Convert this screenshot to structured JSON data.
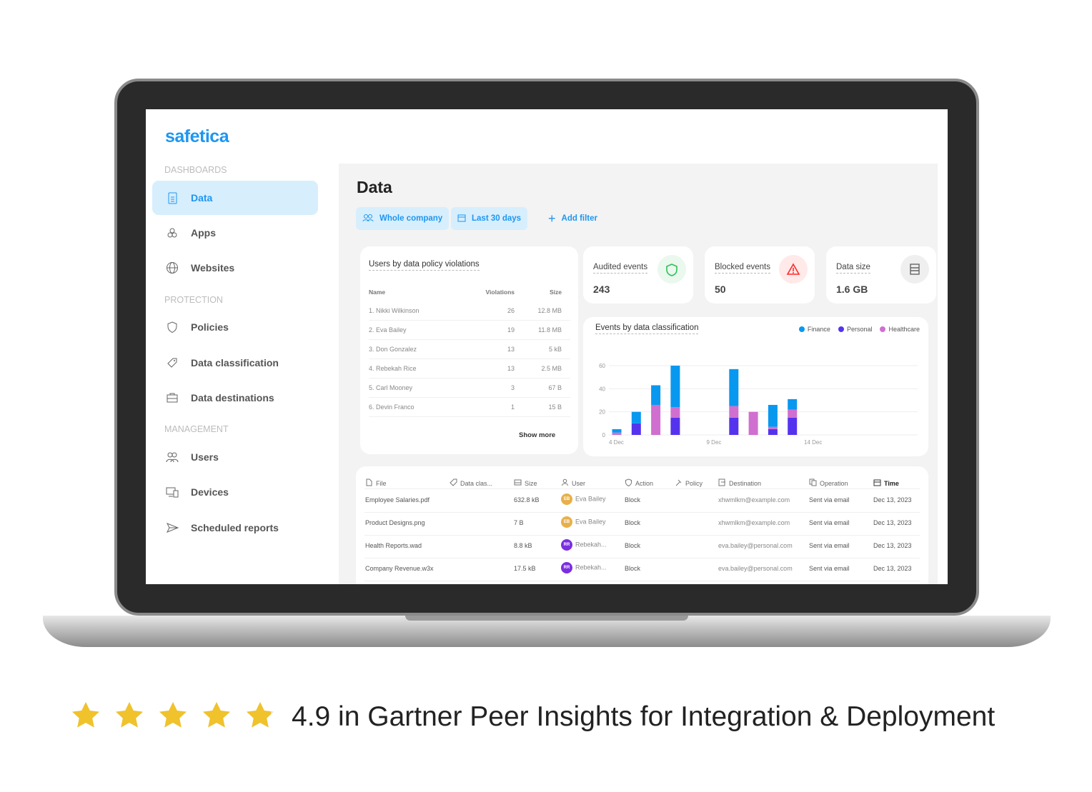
{
  "app": {
    "logo": "safetica"
  },
  "sidebar": {
    "sections": [
      {
        "label": "DASHBOARDS",
        "items": [
          {
            "label": "Data",
            "icon": "document-icon",
            "active": true
          },
          {
            "label": "Apps",
            "icon": "apps-icon"
          },
          {
            "label": "Websites",
            "icon": "globe-icon"
          }
        ]
      },
      {
        "label": "PROTECTION",
        "items": [
          {
            "label": "Policies",
            "icon": "shield-icon"
          },
          {
            "label": "Data classification",
            "icon": "tag-icon"
          },
          {
            "label": "Data destinations",
            "icon": "briefcase-icon"
          }
        ]
      },
      {
        "label": "MANAGEMENT",
        "items": [
          {
            "label": "Users",
            "icon": "users-icon"
          },
          {
            "label": "Devices",
            "icon": "devices-icon"
          },
          {
            "label": "Scheduled reports",
            "icon": "send-icon"
          }
        ]
      }
    ]
  },
  "main": {
    "title": "Data",
    "filters": [
      {
        "label": "Whole company",
        "icon": "users-icon"
      },
      {
        "label": "Last 30 days",
        "icon": "calendar-icon"
      }
    ],
    "add_filter": "Add filter"
  },
  "violations": {
    "title": "Users by data policy violations",
    "columns": [
      "Name",
      "Violations",
      "Size"
    ],
    "rows": [
      [
        "1. Nikki Wilkinson",
        "26",
        "12.8 MB"
      ],
      [
        "2. Eva Bailey",
        "19",
        "11.8 MB"
      ],
      [
        "3. Don Gonzalez",
        "13",
        "5 kB"
      ],
      [
        "4. Rebekah Rice",
        "13",
        "2.5 MB"
      ],
      [
        "5. Carl Mooney",
        "3",
        "67 B"
      ],
      [
        "6. Devin Franco",
        "1",
        "15 B"
      ]
    ],
    "show_more": "Show more"
  },
  "kpis": [
    {
      "label": "Audited events",
      "value": "243",
      "icon": "shield-check-icon",
      "color": "#2fbf5a",
      "bg": "#eaf8ee"
    },
    {
      "label": "Blocked events",
      "value": "50",
      "icon": "warning-icon",
      "color": "#ff2a2a",
      "bg": "#ffe9e9"
    },
    {
      "label": "Data size",
      "value": "1.6 GB",
      "icon": "storage-icon",
      "color": "#666",
      "bg": "#efefef"
    }
  ],
  "chart_data": {
    "type": "bar",
    "stacked": true,
    "title": "Events by data classification",
    "categories": [
      "4 Dec",
      "5 Dec",
      "6 Dec",
      "7 Dec",
      "8 Dec",
      "9 Dec",
      "10 Dec",
      "11 Dec",
      "12 Dec",
      "13 Dec",
      "14 Dec"
    ],
    "x_tick_labels": [
      "4 Dec",
      "9 Dec",
      "14 Dec"
    ],
    "series": [
      {
        "name": "Finance",
        "color": "#0898f0",
        "values": [
          3,
          10,
          17,
          36,
          0,
          0,
          32,
          0,
          19,
          9,
          0
        ]
      },
      {
        "name": "Personal",
        "color": "#5533ee",
        "values": [
          0,
          10,
          0,
          15,
          0,
          0,
          15,
          0,
          5,
          15,
          0
        ]
      },
      {
        "name": "Healthcare",
        "color": "#d06fd0",
        "values": [
          2,
          0,
          26,
          9,
          0,
          0,
          10,
          20,
          2,
          7,
          0
        ]
      }
    ],
    "stack_order": [
      "Personal",
      "Healthcare",
      "Finance"
    ],
    "y_ticks": [
      0,
      20,
      40,
      60
    ],
    "ylim": [
      0,
      60
    ],
    "grid": true,
    "legend": "top-right"
  },
  "events": {
    "columns": [
      {
        "label": "File",
        "icon": "file-icon"
      },
      {
        "label": "Data clas...",
        "icon": "tag-icon"
      },
      {
        "label": "Size",
        "icon": "storage-icon"
      },
      {
        "label": "User",
        "icon": "user-icon"
      },
      {
        "label": "Action",
        "icon": "shield-icon"
      },
      {
        "label": "Policy",
        "icon": "gavel-icon"
      },
      {
        "label": "Destination",
        "icon": "destination-icon"
      },
      {
        "label": "Operation",
        "icon": "copy-icon"
      },
      {
        "label": "Time",
        "icon": "calendar-icon"
      }
    ],
    "rows": [
      {
        "file": "Employee Salaries.pdf",
        "size": "632.8 kB",
        "initials": "EB",
        "user": "Eva Bailey",
        "avatar": "#e8b04a",
        "action": "Block",
        "destination": "xhwmlkm@example.com",
        "operation": "Sent via email",
        "time": "Dec 13, 2023"
      },
      {
        "file": "Product Designs.png",
        "size": "7 B",
        "initials": "EB",
        "user": "Eva Bailey",
        "avatar": "#e8b04a",
        "action": "Block",
        "destination": "xhwmlkm@example.com",
        "operation": "Sent via email",
        "time": "Dec 13, 2023"
      },
      {
        "file": "Health Reports.wad",
        "size": "8.8 kB",
        "initials": "RR",
        "user": "Rebekah...",
        "avatar": "#7a2fe0",
        "action": "Block",
        "destination": "eva.bailey@personal.com",
        "operation": "Sent via email",
        "time": "Dec 13, 2023"
      },
      {
        "file": "Company Revenue.w3x",
        "size": "17.5 kB",
        "initials": "RR",
        "user": "Rebekah...",
        "avatar": "#7a2fe0",
        "action": "Block",
        "destination": "eva.bailey@personal.com",
        "operation": "Sent via email",
        "time": "Dec 13, 2023"
      }
    ]
  },
  "rating": {
    "stars": 4.9,
    "max": 5,
    "color": "#f0c22c",
    "text": "4.9 in Gartner Peer Insights for Integration & Deployment"
  }
}
